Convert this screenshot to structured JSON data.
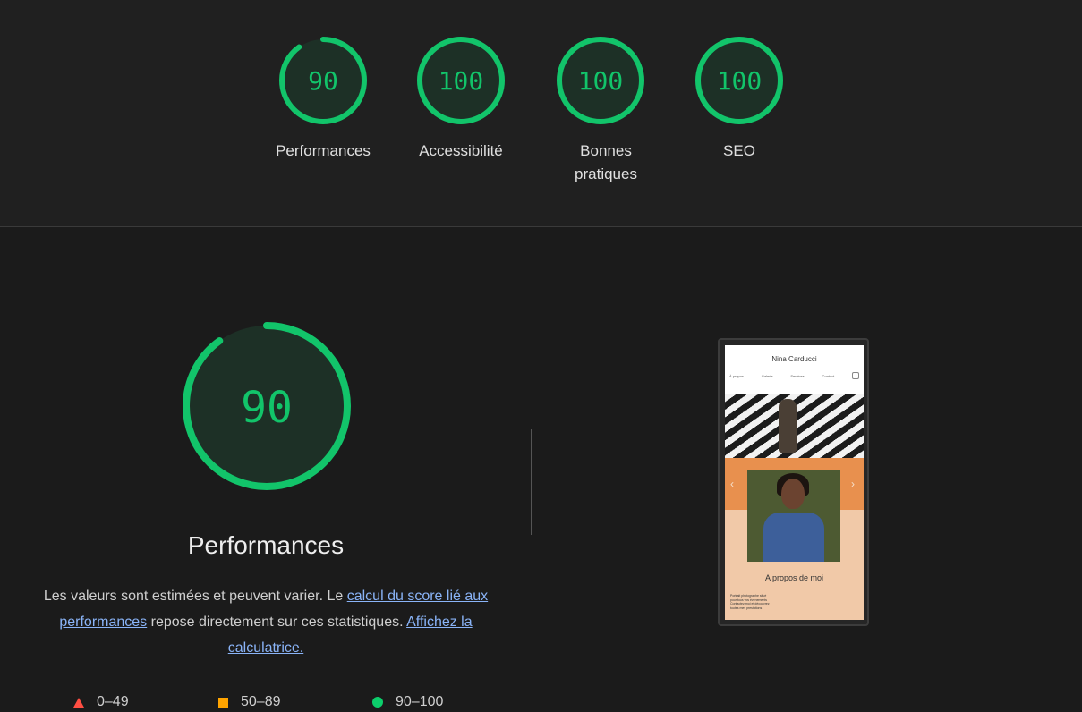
{
  "categories": [
    {
      "score": 90,
      "label": "Performances",
      "fraction": 0.9
    },
    {
      "score": 100,
      "label": "Accessibilité",
      "fraction": 1.0
    },
    {
      "score": 100,
      "label": "Bonnes pratiques",
      "fraction": 1.0
    },
    {
      "score": 100,
      "label": "SEO",
      "fraction": 1.0
    }
  ],
  "main": {
    "score": 90,
    "fraction": 0.9,
    "title": "Performances",
    "desc_prefix": "Les valeurs sont estimées et peuvent varier. Le ",
    "desc_link1": "calcul du score lié aux performances",
    "desc_middle": " repose directement sur ces statistiques. ",
    "desc_link2": "Affichez la calculatrice."
  },
  "legend": [
    {
      "range": "0–49",
      "icon": "triangle-icon",
      "color": "#ff4e42"
    },
    {
      "range": "50–89",
      "icon": "square-icon",
      "color": "#ffa400"
    },
    {
      "range": "90–100",
      "icon": "circle-icon",
      "color": "#0cce6b"
    }
  ],
  "screenshot": {
    "site_title": "Nina Carducci",
    "nav": [
      "À propos",
      "Galerie",
      "Services",
      "Contact"
    ],
    "section_title": "A propos de moi",
    "about_lines": [
      "Portrait photographe situé",
      "pour tous vos événements",
      "Contactez-moi et découvrez",
      "toutes mes prestations"
    ]
  },
  "colors": {
    "pass": "#0cce6b",
    "pass_text": "#12c46a",
    "background": "#1b1b1b"
  }
}
